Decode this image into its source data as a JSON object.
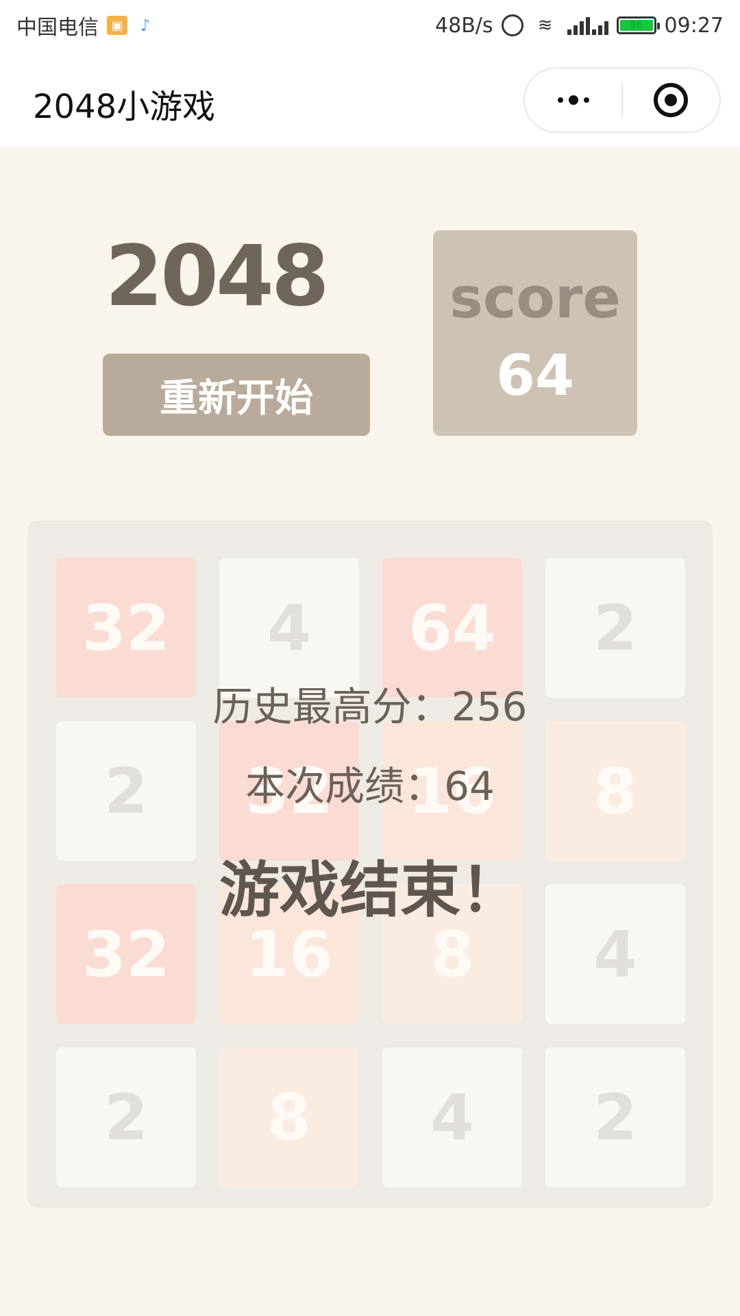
{
  "status_bar": {
    "carrier": "中国电信",
    "network_speed": "48B/s",
    "battery_level": "86",
    "time": "09:27"
  },
  "title_bar": {
    "title": "2048小游戏",
    "more_icon": "more-dots-icon",
    "close_icon": "target-close-icon"
  },
  "header": {
    "game_title": "2048",
    "restart_label": "重新开始",
    "score_label": "score",
    "score_value": "64"
  },
  "board": {
    "rows": [
      [
        "32",
        "4",
        "64",
        "2"
      ],
      [
        "2",
        "32",
        "16",
        "8"
      ],
      [
        "32",
        "16",
        "8",
        "4"
      ],
      [
        "2",
        "8",
        "4",
        "2"
      ]
    ]
  },
  "game_over": {
    "high_score_text": "历史最高分：256",
    "current_score_text": "本次成绩：64",
    "message": "游戏结束！"
  },
  "colors": {
    "background": "#f9f5ed",
    "restart_button": "#b9ab9c",
    "score_box": "#cec2b5",
    "board": "#eeebe6"
  }
}
